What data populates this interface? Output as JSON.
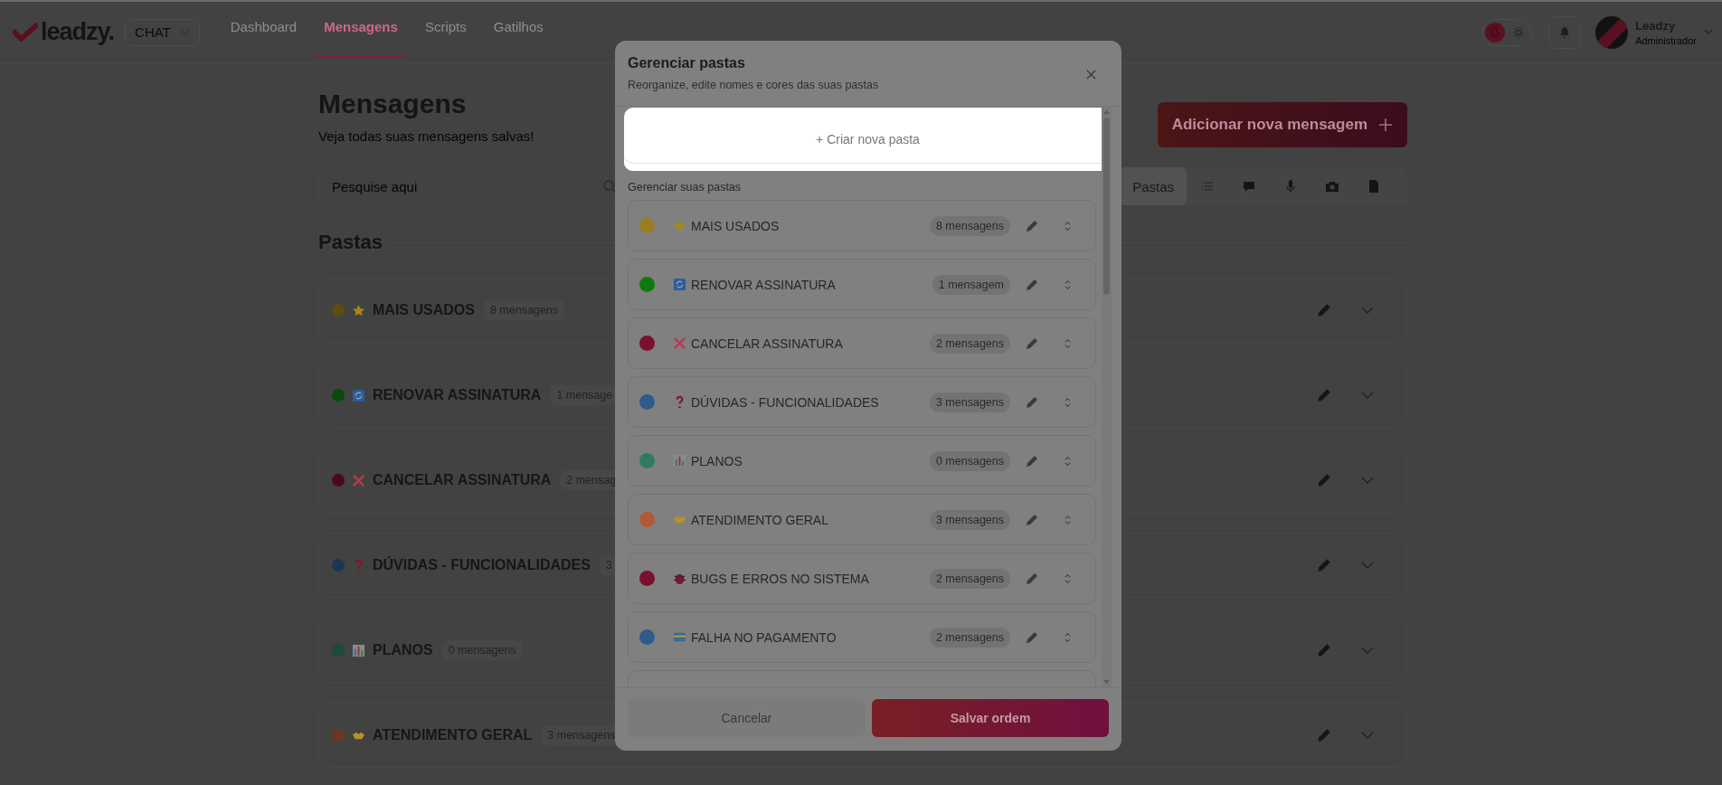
{
  "nav": {
    "logo": "leadzy.",
    "product": "CHAT",
    "tabs": [
      {
        "label": "Dashboard",
        "selected": false
      },
      {
        "label": "Mensagens",
        "selected": true
      },
      {
        "label": "Scripts",
        "selected": false
      },
      {
        "label": "Gatilhos",
        "selected": false
      }
    ],
    "dark_mode": true,
    "user": {
      "name": "Leadzy",
      "role": "Administrador"
    }
  },
  "page": {
    "title": "Mensagens",
    "subtitle": "Veja todas suas mensagens salvas!",
    "add_button": "Adicionar nova mensagem",
    "search": {
      "placeholder": "Pesquise aqui"
    },
    "filters": [
      {
        "kind": "text",
        "label": "Pastas",
        "selected": true
      },
      {
        "kind": "list",
        "selected": false
      },
      {
        "kind": "chat",
        "selected": false
      },
      {
        "kind": "mic",
        "selected": false
      },
      {
        "kind": "camera",
        "selected": false
      },
      {
        "kind": "file",
        "selected": false
      }
    ],
    "section": "Pastas",
    "folders": [
      {
        "name": "MAIS USADOS",
        "color": "#5e4c14",
        "count": "8 mensagens"
      },
      {
        "name": "RENOVAR ASSINATURA",
        "color": "#0a4a0a",
        "count": "1 mensage"
      },
      {
        "name": "CANCELAR ASSINATURA",
        "color": "#4a0a1c",
        "count": "2 mensag"
      },
      {
        "name": "DÚVIDAS - FUNCIONALIDADES",
        "color": "#1c3754",
        "count": "3"
      },
      {
        "name": "PLANOS",
        "color": "#1c4a3c",
        "count": "0 mensagens"
      },
      {
        "name": "ATENDIMENTO GERAL",
        "color": "#6b3721",
        "count": "3 mensagens"
      }
    ]
  },
  "modal": {
    "title": "Gerenciar pastas",
    "subtitle": "Reorganize, edite nomes e cores das suas pastas",
    "create": "+ Criar nova pasta",
    "list_label": "Gerenciar suas pastas",
    "folders": [
      {
        "name": "MAIS USADOS",
        "color": "#9a7c22",
        "count": "8 mensagens"
      },
      {
        "name": "RENOVAR ASSINATURA",
        "color": "#0f7a0f",
        "count": "1 mensagem"
      },
      {
        "name": "CANCELAR ASSINATURA",
        "color": "#7a0f2f",
        "count": "2 mensagens"
      },
      {
        "name": "DÚVIDAS - FUNCIONALIDADES",
        "color": "#2f5b8a",
        "count": "3 mensagens"
      },
      {
        "name": "PLANOS",
        "color": "#2f7a64",
        "count": "0 mensagens"
      },
      {
        "name": "ATENDIMENTO GERAL",
        "color": "#b05a36",
        "count": "3 mensagens"
      },
      {
        "name": "BUGS E ERROS NO SISTEMA",
        "color": "#7a0f2f",
        "count": "2 mensagens"
      },
      {
        "name": "FALHA NO PAGAMENTO",
        "color": "#2f5b8a",
        "count": "2 mensagens"
      }
    ],
    "cancel": "Cancelar",
    "save": "Salvar ordem"
  }
}
